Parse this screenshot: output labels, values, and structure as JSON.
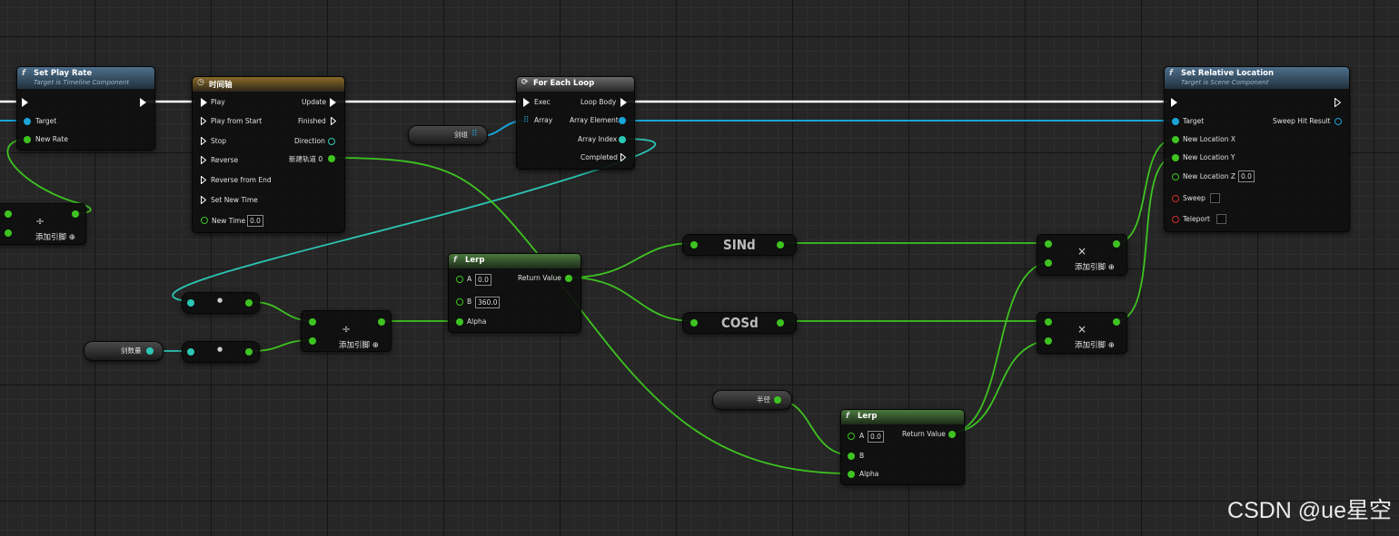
{
  "set_play_rate": {
    "title": "Set Play Rate",
    "subtitle": "Target is Timeline Component",
    "target": "Target",
    "new_rate": "New Rate"
  },
  "timeline": {
    "title": "时间轴",
    "play": "Play",
    "play_from_start": "Play from Start",
    "stop": "Stop",
    "reverse": "Reverse",
    "reverse_from_end": "Reverse from End",
    "set_new_time": "Set New Time",
    "new_time": "New Time",
    "new_time_value": "0.0",
    "update": "Update",
    "finished": "Finished",
    "direction": "Direction",
    "track": "新建轨道 0"
  },
  "for_each": {
    "title": "For Each Loop",
    "exec": "Exec",
    "array": "Array",
    "loop_body": "Loop Body",
    "array_element": "Array Element",
    "array_index": "Array Index",
    "completed": "Completed"
  },
  "set_rel_loc": {
    "title": "Set Relative Location",
    "subtitle": "Target is Scene Component",
    "target": "Target",
    "new_x": "New Location X",
    "new_y": "New Location Y",
    "new_z": "New Location Z",
    "new_z_value": "0.0",
    "sweep": "Sweep",
    "teleport": "Teleport",
    "sweep_hit": "Sweep Hit Result"
  },
  "lerp1": {
    "title": "Lerp",
    "a": "A",
    "a_value": "0.0",
    "b": "B",
    "b_value": "360.0",
    "alpha": "Alpha",
    "return_value": "Return Value"
  },
  "lerp2": {
    "title": "Lerp",
    "a": "A",
    "a_value": "0.0",
    "b": "B",
    "alpha": "Alpha",
    "return_value": "Return Value"
  },
  "vars": {
    "sword_array": "剑组",
    "sword_count": "剑数量",
    "radius": "半径"
  },
  "math": {
    "sin": "SINd",
    "cos": "COSd",
    "divide": "÷",
    "multiply": "×",
    "dot": "●",
    "add_pin": "添加引脚",
    "add_icon": "⊕"
  },
  "colors": {
    "exec": "#ffffff",
    "float": "#3ec321",
    "object": "#1aa4d8",
    "integer": "#2bc7b4",
    "bool": "#d22b2b"
  },
  "watermark": "CSDN @ue星空"
}
